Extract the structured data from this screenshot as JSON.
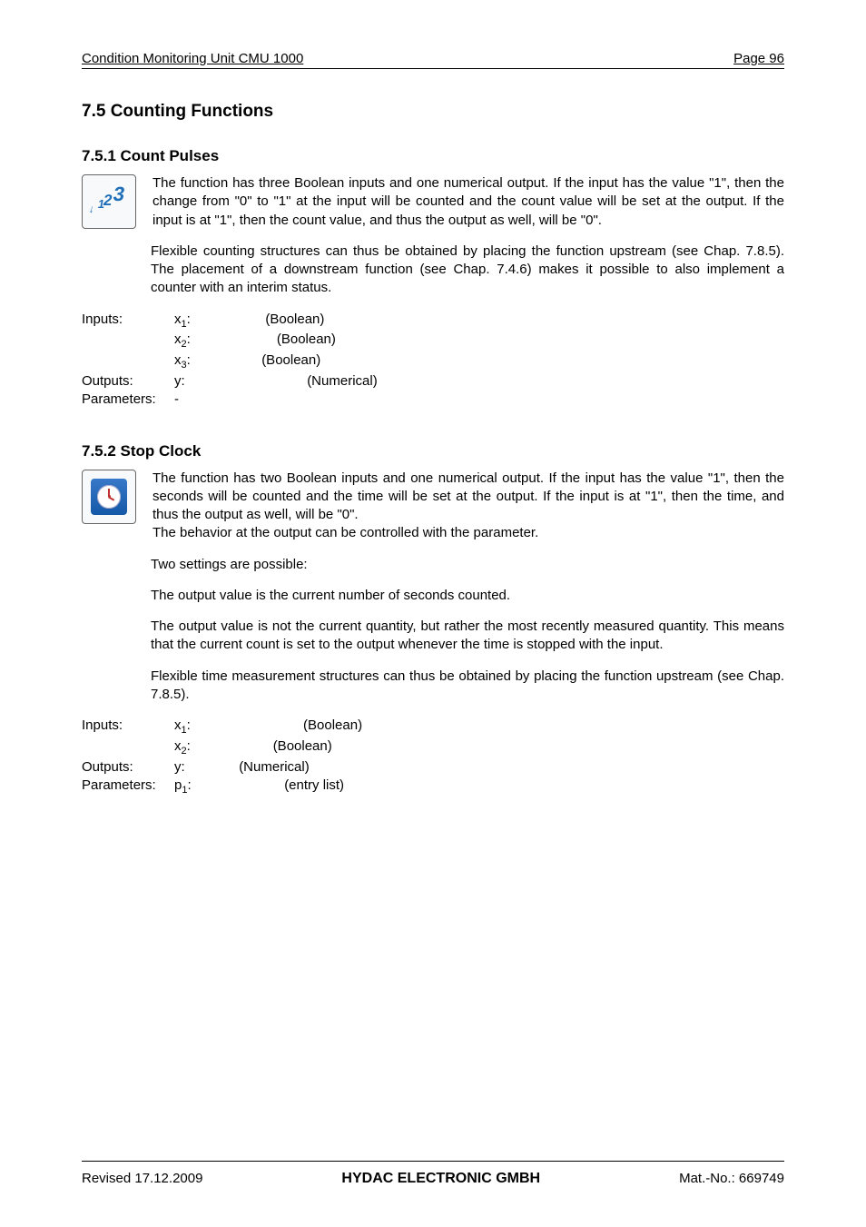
{
  "header": {
    "left": "Condition Monitoring Unit CMU 1000",
    "right": "Page 96"
  },
  "h_main": "7.5  Counting Functions",
  "count_pulses": {
    "h": "7.5.1  Count Pulses",
    "p1": "The                              function has three Boolean inputs and one numerical output. If the                input has the value \"1\", then the change from \"0\" to \"1\" at the              input will be counted and the count value will be set at the output. If the            input is at \"1\", then the count value, and thus the output as well, will be \"0\".",
    "p2": "Flexible counting structures can thus be obtained by placing the                                function  upstream  (see  Chap.  7.8.5).  The placement of a downstream                     function (see Chap. 7.4.6) makes it possible to also implement a counter with an interim status.",
    "io": {
      "inputs_label": "Inputs:",
      "out_label": "Outputs:",
      "param_label": "Parameters:",
      "x1": "x",
      "x1s": "1",
      "x1v": "(Boolean)",
      "x2": "x",
      "x2s": "2",
      "x2v": "(Boolean)",
      "x3": "x",
      "x3s": "3",
      "x3v": "(Boolean)",
      "y": "y:",
      "yv": "(Numerical)",
      "p": "-"
    }
  },
  "stop_clock": {
    "h": "7.5.2  Stop Clock",
    "p1": "The                  function has two Boolean inputs and one numerical output. If the                input has the value \"1\", then the seconds will be counted and the time will be set at the output. If the            input is at \"1\", then the time, and thus the output as well, will be \"0\".",
    "p1b": "The behavior at the output can be controlled with the parameter.",
    "p2": "Two settings are possible:",
    "p3": "The output value is the current number of seconds counted.",
    "p4": "The output value is not the current quantity, but rather the most recently measured quantity. This means that the current count is set to the output whenever the time is stopped with the                  input.",
    "p5": "Flexible time measurement structures can thus be obtained by placing the                              function upstream (see Chap. 7.8.5).",
    "io": {
      "inputs_label": "Inputs:",
      "out_label": "Outputs:",
      "param_label": "Parameters:",
      "x1": "x",
      "x1s": "1",
      "x1v": "(Boolean)",
      "x2": "x",
      "x2s": "2",
      "x2v": "(Boolean)",
      "y": "y:",
      "yv": "(Numerical)",
      "p": "p",
      "ps": "1",
      "pv": "(entry list)"
    }
  },
  "footer": {
    "left": "Revised 17.12.2009",
    "center": "HYDAC ELECTRONIC GMBH",
    "right": "Mat.-No.: 669749"
  }
}
